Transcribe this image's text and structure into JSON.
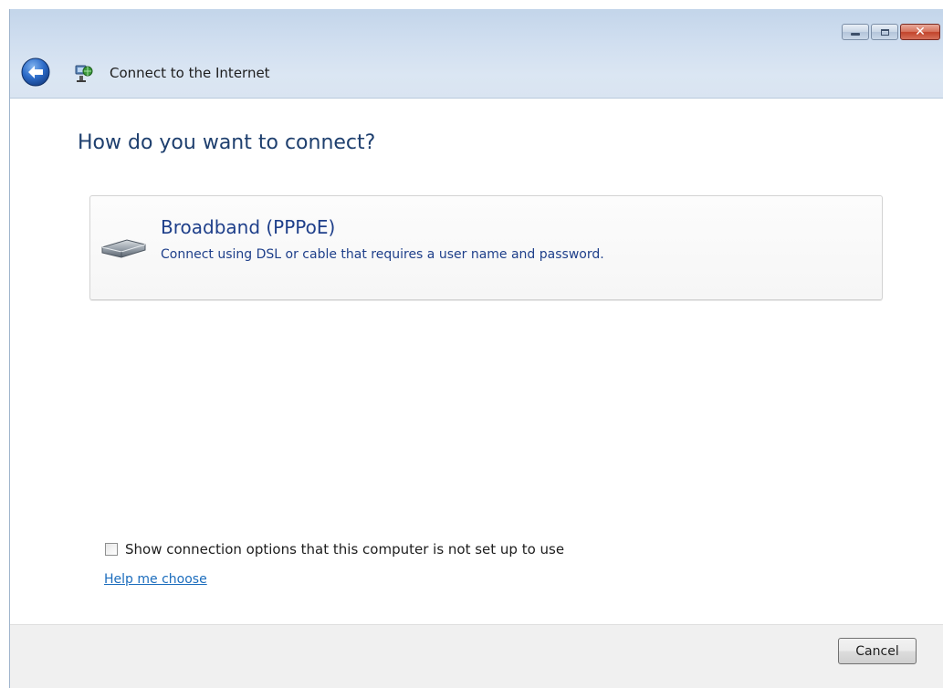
{
  "window": {
    "title": "Connect to the Internet",
    "controls": {
      "minimize": "minimize-icon",
      "maximize": "maximize-icon",
      "close": "close-icon"
    }
  },
  "page": {
    "heading": "How do you want to connect?"
  },
  "options": [
    {
      "icon": "modem-icon",
      "title": "Broadband (PPPoE)",
      "description": "Connect using DSL or cable that requires a user name and password."
    }
  ],
  "show_options": {
    "label": "Show connection options that this computer is not set up to use",
    "checked": false
  },
  "help_link": "Help me choose",
  "footer": {
    "cancel_label": "Cancel"
  },
  "colors": {
    "heading": "#1e3f6e",
    "option_text": "#1e3f8a",
    "link": "#1c6dbd",
    "titlebar": "#d1dff0",
    "footer": "#f0f0f0"
  }
}
